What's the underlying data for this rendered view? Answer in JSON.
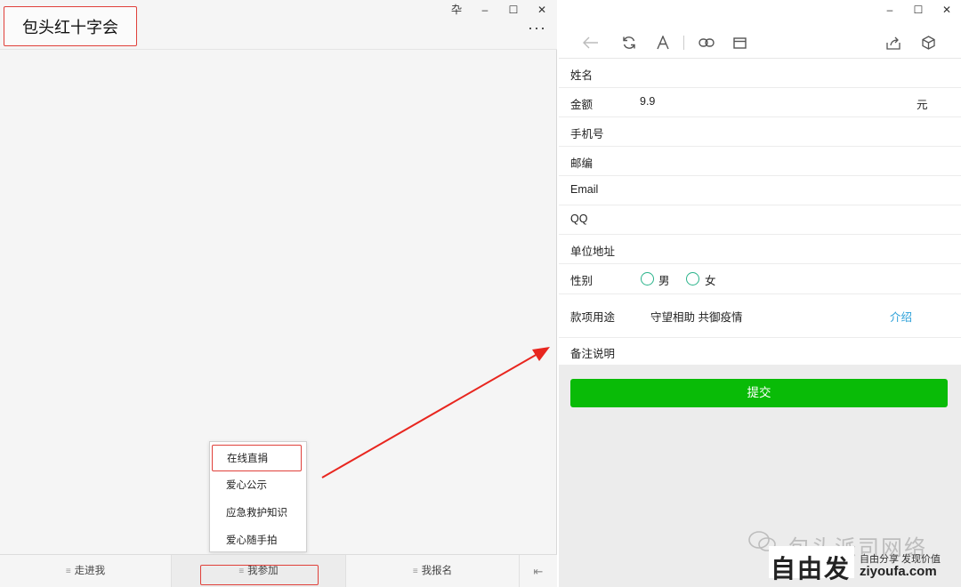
{
  "left_window": {
    "title": "包头红十字会",
    "window_controls": [
      "卆",
      "–",
      "☐",
      "✕"
    ],
    "more_label": "···",
    "popup_menu": {
      "items": [
        {
          "label": "在线直捐",
          "selected": true
        },
        {
          "label": "爱心公示",
          "selected": false
        },
        {
          "label": "应急救护知识",
          "selected": false
        },
        {
          "label": "爱心随手拍",
          "selected": false
        }
      ]
    },
    "bottom_nav": {
      "items": [
        {
          "label": "走进我",
          "glyph": "≡"
        },
        {
          "label": "我参加",
          "glyph": "≡"
        },
        {
          "label": "我报名",
          "glyph": "≡"
        }
      ],
      "toggle_glyph": "⇤"
    }
  },
  "right_window": {
    "window_controls": [
      "–",
      "☐",
      "✕"
    ],
    "toolbar_icons": [
      "back-arrow-icon",
      "refresh-icon",
      "font-icon",
      "link-icon",
      "window-icon",
      "share-icon",
      "cube-icon"
    ],
    "form": {
      "name_label": "姓名",
      "amount_label": "金额",
      "amount_value": "9.9",
      "amount_unit": "元",
      "phone_label": "手机号",
      "postcode_label": "邮编",
      "email_label": "Email",
      "qq_label": "QQ",
      "address_label": "单位地址",
      "gender_label": "性别",
      "gender_male": "男",
      "gender_female": "女",
      "purpose_label": "款项用途",
      "purpose_value": "守望相助 共御疫情",
      "intro_link": "介绍",
      "remark_label": "备注说明"
    },
    "submit_label": "提交"
  },
  "watermark": {
    "line1": "包头派司网络",
    "logo_text": "自由发",
    "slogan": "自由分享 发现价值",
    "domain": "ziyoufa.com"
  },
  "colors": {
    "highlight_red": "#e0403a",
    "submit_green": "#09bb07",
    "radio_teal": "#29b38a",
    "link_blue": "#2a9fd8",
    "arrow_red": "#e8261f"
  }
}
